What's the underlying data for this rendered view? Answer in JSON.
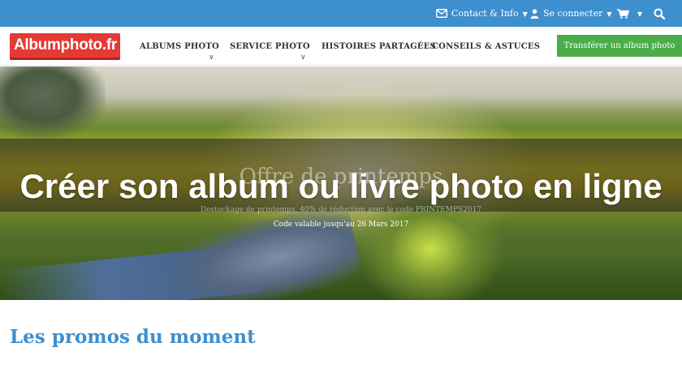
{
  "topbar": {
    "contact_label": "Contact & Info",
    "login_label": "Se connecter",
    "contact_icon": "envelope-icon",
    "login_icon": "user-icon",
    "cart_icon": "cart-icon",
    "search_icon": "search-icon",
    "background_color": "#3d8fce"
  },
  "logo": {
    "text": "Albumphoto.fr",
    "color": "#e53935"
  },
  "nav": {
    "items": [
      {
        "label": "ALBUMS PHOTO"
      },
      {
        "label": "SERVICE PHOTO"
      },
      {
        "label": "HISTOIRES PARTAGÉES"
      },
      {
        "label": "CONSEILS & ASTUCES"
      }
    ],
    "cta_label": "Transférer un album photo",
    "cta_color": "#4aad4a"
  },
  "hero": {
    "offer_title": "Offre de printemps",
    "offer_subtitle": "Destockage de printemps, 40% de réduction avec le code PRINTEMPS2017",
    "offer_validity": "Code valable jusqu'au 26 Mars 2017",
    "headline": "Créer son album ou livre photo en ligne"
  },
  "promos": {
    "title": "Les promos du moment",
    "title_color": "#3d8fce"
  }
}
